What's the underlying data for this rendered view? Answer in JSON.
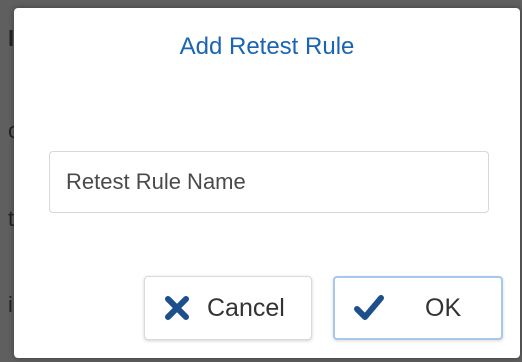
{
  "background_fragments": [
    "l",
    "c",
    "t",
    "i"
  ],
  "dialog": {
    "title": "Add Retest Rule",
    "input": {
      "placeholder": "Retest Rule Name",
      "value": ""
    },
    "buttons": {
      "cancel": {
        "label": "Cancel",
        "icon": "close-icon"
      },
      "ok": {
        "label": "OK",
        "icon": "checkmark-icon"
      }
    }
  },
  "colors": {
    "accent": "#1a64b4",
    "backdrop": "#5f5f5f",
    "ok_border": "#a9c7ea"
  }
}
